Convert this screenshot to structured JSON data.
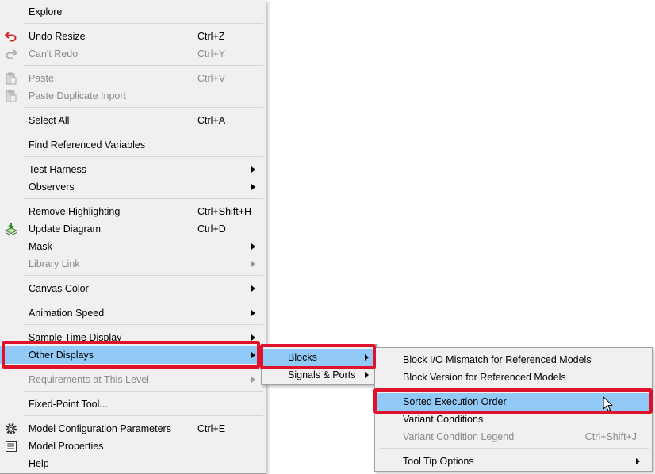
{
  "main_menu": {
    "items": [
      {
        "label": "Explore",
        "shortcut": "",
        "disabled": false
      },
      {
        "label": "Undo Resize",
        "shortcut": "Ctrl+Z",
        "icon": "undo-icon"
      },
      {
        "label": "Can't Redo",
        "shortcut": "Ctrl+Y",
        "icon": "redo-icon",
        "disabled": true
      },
      {
        "label": "Paste",
        "shortcut": "Ctrl+V",
        "icon": "paste-icon",
        "disabled": true
      },
      {
        "label": "Paste Duplicate Inport",
        "shortcut": "",
        "icon": "paste-icon",
        "disabled": true
      },
      {
        "label": "Select All",
        "shortcut": "Ctrl+A"
      },
      {
        "label": "Find Referenced Variables",
        "shortcut": ""
      },
      {
        "label": "Test Harness",
        "submenu": true
      },
      {
        "label": "Observers",
        "submenu": true
      },
      {
        "label": "Remove Highlighting",
        "shortcut": "Ctrl+Shift+H"
      },
      {
        "label": "Update Diagram",
        "shortcut": "Ctrl+D",
        "icon": "update-diagram-icon"
      },
      {
        "label": "Mask",
        "submenu": true
      },
      {
        "label": "Library Link",
        "submenu": true,
        "disabled": true
      },
      {
        "label": "Canvas Color",
        "submenu": true
      },
      {
        "label": "Animation Speed",
        "submenu": true
      },
      {
        "label": "Sample Time Display",
        "submenu": true
      },
      {
        "label": "Other Displays",
        "submenu": true,
        "highlighted": true
      },
      {
        "label": "Requirements at This Level",
        "submenu": true,
        "disabled": true
      },
      {
        "label": "Fixed-Point Tool...",
        "shortcut": ""
      },
      {
        "label": "Model Configuration Parameters",
        "shortcut": "Ctrl+E",
        "icon": "gear-icon"
      },
      {
        "label": "Model Properties",
        "shortcut": "",
        "icon": "properties-icon"
      },
      {
        "label": "Help",
        "shortcut": ""
      }
    ]
  },
  "other_displays_submenu": {
    "items": [
      {
        "label": "Blocks",
        "submenu": true,
        "highlighted": true
      },
      {
        "label": "Signals & Ports",
        "submenu": true
      }
    ]
  },
  "blocks_submenu": {
    "items": [
      {
        "label": "Block I/O Mismatch for Referenced Models"
      },
      {
        "label": "Block Version for Referenced Models"
      },
      {
        "label": "Sorted Execution Order",
        "highlighted": true
      },
      {
        "label": "Variant Conditions"
      },
      {
        "label": "Variant Condition Legend",
        "shortcut": "Ctrl+Shift+J",
        "disabled": true
      },
      {
        "label": "Tool Tip Options",
        "submenu": true
      }
    ]
  },
  "colors": {
    "menu_bg": "#f0f0f0",
    "highlight": "#91c9f7",
    "callout_red": "#e0112b",
    "disabled_text": "#8a8a8a"
  }
}
